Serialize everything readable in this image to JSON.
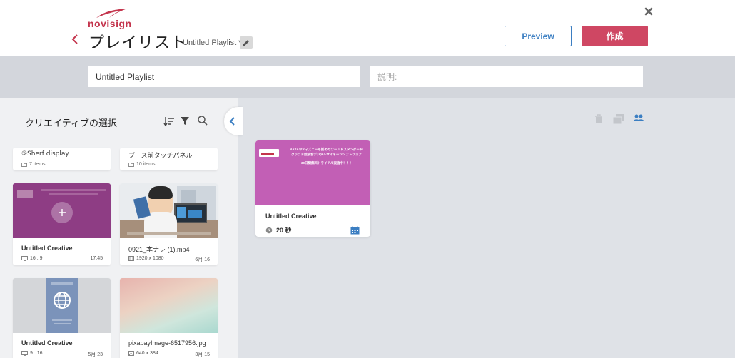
{
  "header": {
    "logo_text": "novisign",
    "title": "プレイリスト",
    "playlist_name": "Untitled Playlist *",
    "preview_label": "Preview",
    "create_label": "作成"
  },
  "form": {
    "name_value": "Untitled Playlist",
    "description_placeholder": "説明:"
  },
  "left_panel": {
    "title": "クリエイティブの選択",
    "folders": [
      {
        "name": "⑤Sherf display",
        "count": "7 items"
      },
      {
        "name": "ブース前タッチパネル",
        "count": "10 items"
      }
    ],
    "media": [
      {
        "name": "Untitled Creative",
        "meta": "16 : 9",
        "date": "17:45"
      },
      {
        "name": "0921_本ナレ (1).mp4",
        "meta": "1920 x 1080",
        "date": "6月 16"
      },
      {
        "name": "Untitled Creative",
        "meta": "9 : 16",
        "date": "5月 23"
      },
      {
        "name": "pixabayImage-6517956.jpg",
        "meta": "640 x 384",
        "date": "3月 15"
      }
    ]
  },
  "playlist": {
    "items": [
      {
        "name": "Untitled Creative",
        "duration": "20 秒",
        "thumb_lines": [
          "NASAやディズニーも認めたワールドスタンダード",
          "クラウド型統合デジタルサイネージソフトウェア",
          "30日間無料トライアル実施中！！！"
        ]
      }
    ]
  },
  "colors": {
    "accent_blue": "#3b7ec2",
    "create_red": "#cf4763",
    "brand_red": "#c4354d",
    "creative_purple": "#c25fb5"
  }
}
